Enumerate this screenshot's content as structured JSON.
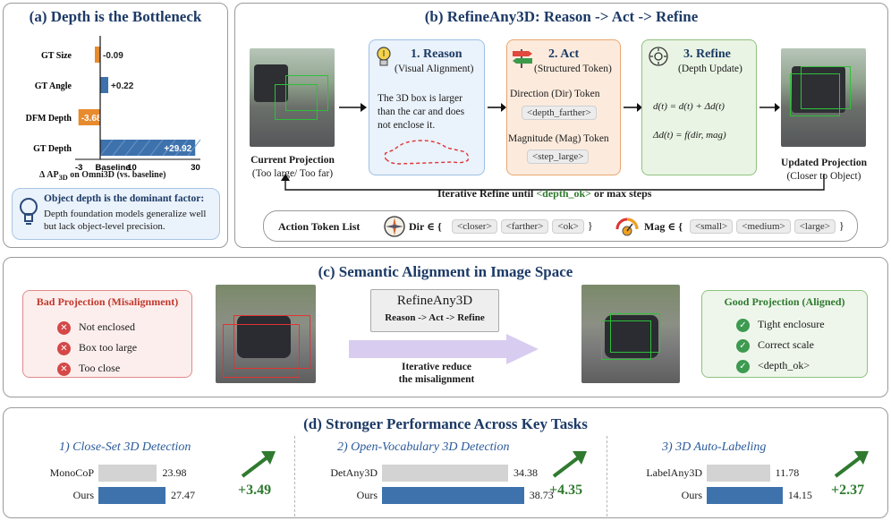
{
  "panel_a": {
    "title": "(a) Depth is the Bottleneck",
    "rows": [
      {
        "label": "GT Size",
        "value": -0.09,
        "value_label": "-0.09",
        "color": "#e88a2e"
      },
      {
        "label": "GT Angle",
        "value": 0.22,
        "value_label": "+0.22",
        "color": "#3e72ad"
      },
      {
        "label": "DFM Depth",
        "value": -3.68,
        "value_label": "-3.68",
        "color": "#e88a2e"
      },
      {
        "label": "GT Depth",
        "value": 29.92,
        "value_label": "+29.92",
        "color": "#3e72ad"
      }
    ],
    "axis_ticks": [
      "-3",
      "Baseline",
      "10",
      "30"
    ],
    "xlabel": "Δ AP3D on Omni3D (vs. baseline)",
    "note_title": "Object depth is the dominant factor:",
    "note_body": "Depth foundation models generalize well but lack object-level precision."
  },
  "panel_b": {
    "title": "(b) RefineAny3D: Reason -> Act -> Refine",
    "current_label": "Current Projection",
    "current_sub": "(Too large/ Too far)",
    "updated_label": "Updated Projection",
    "updated_sub": "(Closer to Object)",
    "reason_title": "1. Reason",
    "reason_sub": "(Visual Alignment)",
    "reason_text": "The 3D box is larger than the car and does not enclose it.",
    "act_title": "2. Act",
    "act_sub": "(Structured Token)",
    "dir_label": "Direction (Dir) Token",
    "dir_token": "<depth_farther>",
    "mag_label": "Magnitude (Mag) Token",
    "mag_token": "<step_large>",
    "refine_title": "3. Refine",
    "refine_sub": "(Depth Update)",
    "eq1": "d(t) = d(t) + Δd(t)",
    "eq2": "Δd(t) = f(dir, mag)",
    "loop_prefix": "Iterative Refine until ",
    "loop_token": "<depth_ok>",
    "loop_suffix": " or max steps",
    "token_list_label": "Action Token List",
    "dir_set_label": "Dir ∈ {",
    "dir_tokens": [
      "<closer>",
      "<farther>",
      "<ok>"
    ],
    "mag_set_label": "Mag ∈ {",
    "mag_tokens": [
      "<small>",
      "<medium>",
      "<large>"
    ],
    "close_brace": "}"
  },
  "panel_c": {
    "title": "(c) Semantic Alignment in Image Space",
    "bad_title": "Bad Projection (Misalignment)",
    "bad_items": [
      "Not enclosed",
      "Box too large",
      "Too close"
    ],
    "center_title": "RefineAny3D",
    "center_sub": "Reason -> Act -> Refine",
    "arrow_caption_1": "Iterative reduce",
    "arrow_caption_2": "the misalignment",
    "good_title": "Good Projection (Aligned)",
    "good_items": [
      "Tight enclosure",
      "Correct scale",
      "<depth_ok>"
    ]
  },
  "panel_d": {
    "title": "(d) Stronger Performance Across Key Tasks",
    "chart_data": [
      {
        "type": "bar",
        "title": "1) Close-Set 3D Detection",
        "categories": [
          "MonoCoP",
          "Ours"
        ],
        "values": [
          23.98,
          27.47
        ],
        "gain": "+3.49"
      },
      {
        "type": "bar",
        "title": "2) Open-Vocabulary 3D Detection",
        "categories": [
          "DetAny3D",
          "Ours"
        ],
        "values": [
          34.38,
          38.73
        ],
        "gain": "+4.35"
      },
      {
        "type": "bar",
        "title": "3) 3D Auto-Labeling",
        "categories": [
          "LabelAny3D",
          "Ours"
        ],
        "values": [
          11.78,
          14.15
        ],
        "gain": "+2.37"
      }
    ],
    "value_labels": [
      [
        "23.98",
        "27.47"
      ],
      [
        "34.38",
        "38.73"
      ],
      [
        "11.78",
        "14.15"
      ]
    ]
  },
  "colors": {
    "title_blue": "#1c3a66",
    "bar_blue": "#3e72ad",
    "bar_orange": "#e88a2e",
    "gain_green": "#2f7a2f",
    "bad_red": "#c0392b"
  }
}
